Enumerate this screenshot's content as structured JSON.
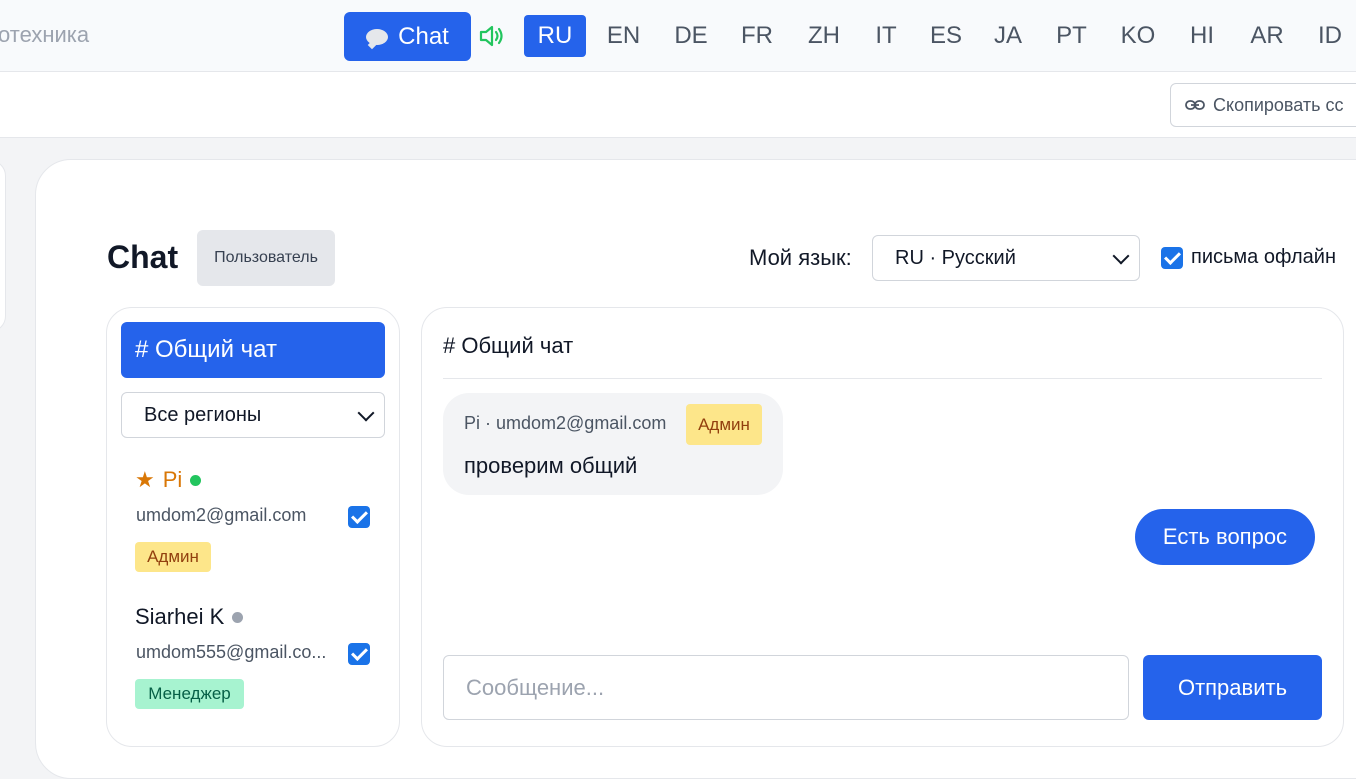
{
  "header": {
    "brand_fragment": "отехника",
    "chat_button_label": "Chat",
    "languages": [
      {
        "code": "RU",
        "active": true
      },
      {
        "code": "EN",
        "active": false
      },
      {
        "code": "DE",
        "active": false
      },
      {
        "code": "FR",
        "active": false
      },
      {
        "code": "ZH",
        "active": false
      },
      {
        "code": "IT",
        "active": false
      },
      {
        "code": "ES",
        "active": false
      },
      {
        "code": "JA",
        "active": false
      },
      {
        "code": "PT",
        "active": false
      },
      {
        "code": "KO",
        "active": false
      },
      {
        "code": "HI",
        "active": false
      },
      {
        "code": "AR",
        "active": false
      },
      {
        "code": "ID",
        "active": false
      }
    ]
  },
  "subbar": {
    "copy_label": "Скопировать сс"
  },
  "chat": {
    "title": "Chat",
    "role": "Пользователь",
    "my_language_label": "Мой язык:",
    "my_language_value": "RU · Русский",
    "offline_label": "письма офлайн",
    "offline_checked": true
  },
  "sidebar": {
    "channel": "# Общий чат",
    "region_value": "Все регионы",
    "users": [
      {
        "name": "Pi",
        "starred": true,
        "star": "★",
        "online": true,
        "email": "umdom2@gmail.com",
        "role": "Админ",
        "checked": true
      },
      {
        "name": "Siarhei K",
        "starred": false,
        "online": false,
        "email": "umdom555@gmail.co...",
        "role": "Менеджер",
        "checked": true
      }
    ]
  },
  "conversation": {
    "header": "# Общий чат",
    "messages": [
      {
        "direction": "in",
        "author": "Pi · umdom2@gmail.com",
        "role": "Админ",
        "text": "проверим общий"
      },
      {
        "direction": "out",
        "text": "Есть вопрос"
      }
    ],
    "input_placeholder": "Сообщение...",
    "send_label": "Отправить"
  },
  "colors": {
    "accent": "#2563eb",
    "online": "#22c55e",
    "offline": "#9ca3af",
    "speaker": "#22c55e",
    "admin_name": "#d97706"
  }
}
